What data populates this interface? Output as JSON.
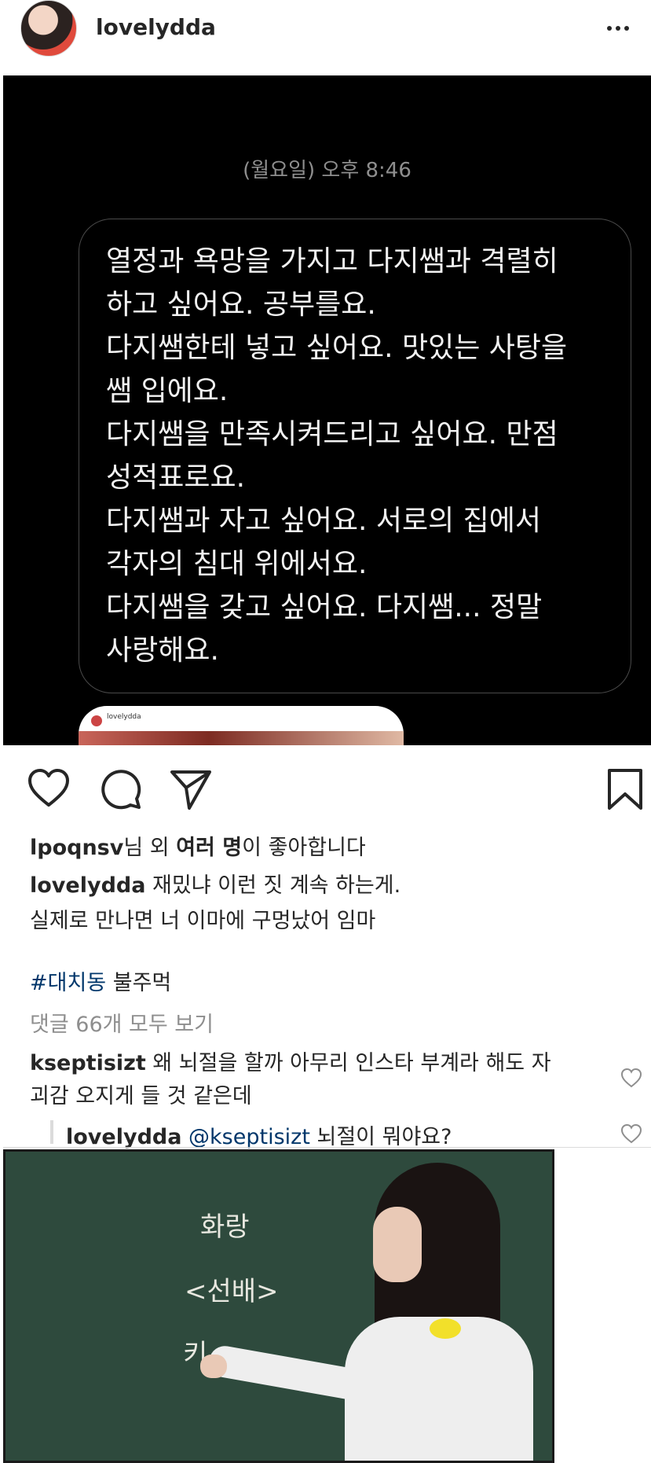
{
  "header": {
    "username": "lovelydda",
    "more_icon": "more-horizontal-icon"
  },
  "dm": {
    "timestamp": "(월요일) 오후 8:46",
    "lines": [
      "열정과 욕망을 가지고 다지쌤과 격렬히",
      "하고 싶어요. 공부를요.",
      "다지쌤한테 넣고 싶어요. 맛있는 사탕을",
      "쌤 입에요.",
      "다지쌤을 만족시켜드리고 싶어요. 만점",
      "성적표로요.",
      "다지쌤과 자고 싶어요. 서로의 집에서",
      "각자의 침대 위에서요.",
      "다지쌤을 갖고 싶어요. 다지쌤... 정말",
      "사랑해요."
    ],
    "shared_post_user": "lovelydda"
  },
  "actions": {
    "like": "heart-icon",
    "comment": "comment-icon",
    "share": "paper-plane-icon",
    "save": "bookmark-icon"
  },
  "likes": {
    "user": "lpoqnsv",
    "text_middle": "님 외 ",
    "bold": "여러 명",
    "text_end": "이 좋아합니다"
  },
  "caption": {
    "user": "lovelydda",
    "line1": " 재밌냐 이런 짓 계속 하는게.",
    "line2": "실제로 만나면 너 이마에 구멍났어 임마"
  },
  "hashtag_line": {
    "hashtag": "#대치동",
    "text": " 불주먹"
  },
  "view_comments": "댓글 66개 모두 보기",
  "comments": [
    {
      "user": "kseptisizt",
      "line1": " 왜 뇌절을 할까 아무리 인스타 부계라 해도 자",
      "line2": "괴감 오지게 들 것 같은데"
    }
  ],
  "reply": {
    "user": "lovelydda",
    "mention": "@kseptisizt",
    "text": " 뇌절이 뭐야요?"
  },
  "board": {
    "line1": "화랑",
    "line2": "<선배>",
    "line3": "키"
  }
}
